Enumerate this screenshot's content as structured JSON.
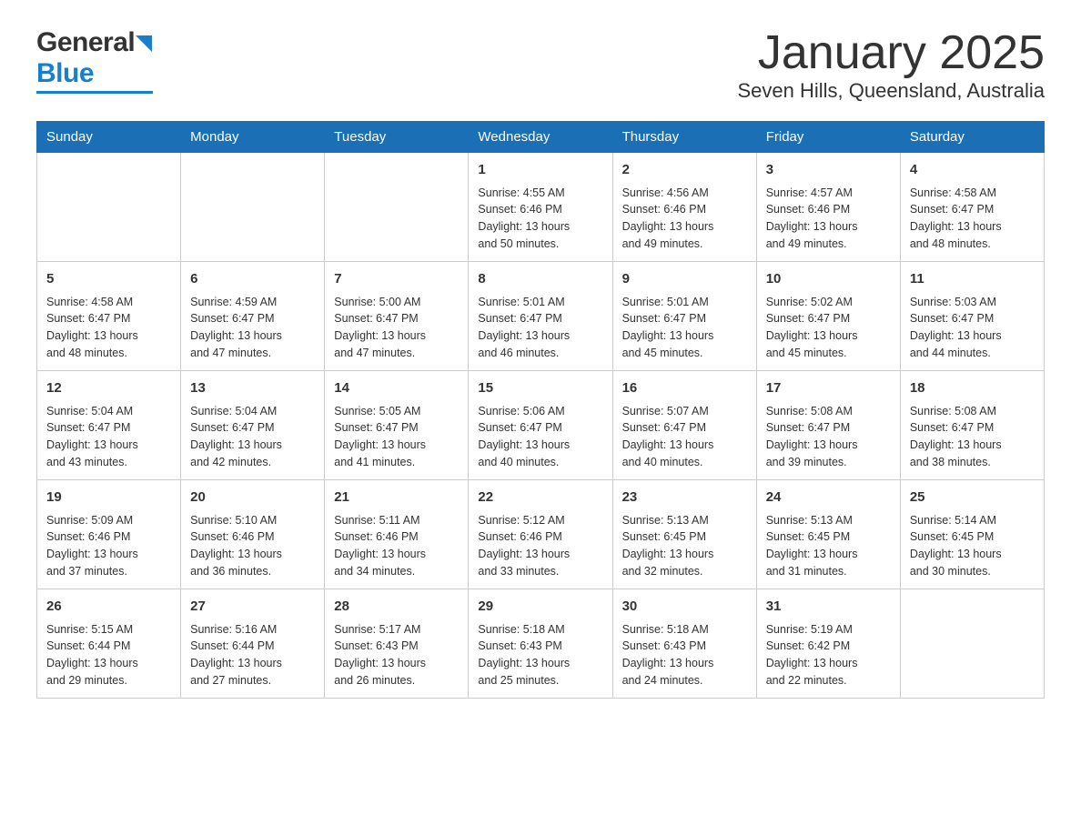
{
  "logo": {
    "general": "General",
    "blue": "Blue"
  },
  "header": {
    "month": "January 2025",
    "location": "Seven Hills, Queensland, Australia"
  },
  "weekdays": [
    "Sunday",
    "Monday",
    "Tuesday",
    "Wednesday",
    "Thursday",
    "Friday",
    "Saturday"
  ],
  "weeks": [
    [
      {
        "day": "",
        "info": ""
      },
      {
        "day": "",
        "info": ""
      },
      {
        "day": "",
        "info": ""
      },
      {
        "day": "1",
        "info": "Sunrise: 4:55 AM\nSunset: 6:46 PM\nDaylight: 13 hours\nand 50 minutes."
      },
      {
        "day": "2",
        "info": "Sunrise: 4:56 AM\nSunset: 6:46 PM\nDaylight: 13 hours\nand 49 minutes."
      },
      {
        "day": "3",
        "info": "Sunrise: 4:57 AM\nSunset: 6:46 PM\nDaylight: 13 hours\nand 49 minutes."
      },
      {
        "day": "4",
        "info": "Sunrise: 4:58 AM\nSunset: 6:47 PM\nDaylight: 13 hours\nand 48 minutes."
      }
    ],
    [
      {
        "day": "5",
        "info": "Sunrise: 4:58 AM\nSunset: 6:47 PM\nDaylight: 13 hours\nand 48 minutes."
      },
      {
        "day": "6",
        "info": "Sunrise: 4:59 AM\nSunset: 6:47 PM\nDaylight: 13 hours\nand 47 minutes."
      },
      {
        "day": "7",
        "info": "Sunrise: 5:00 AM\nSunset: 6:47 PM\nDaylight: 13 hours\nand 47 minutes."
      },
      {
        "day": "8",
        "info": "Sunrise: 5:01 AM\nSunset: 6:47 PM\nDaylight: 13 hours\nand 46 minutes."
      },
      {
        "day": "9",
        "info": "Sunrise: 5:01 AM\nSunset: 6:47 PM\nDaylight: 13 hours\nand 45 minutes."
      },
      {
        "day": "10",
        "info": "Sunrise: 5:02 AM\nSunset: 6:47 PM\nDaylight: 13 hours\nand 45 minutes."
      },
      {
        "day": "11",
        "info": "Sunrise: 5:03 AM\nSunset: 6:47 PM\nDaylight: 13 hours\nand 44 minutes."
      }
    ],
    [
      {
        "day": "12",
        "info": "Sunrise: 5:04 AM\nSunset: 6:47 PM\nDaylight: 13 hours\nand 43 minutes."
      },
      {
        "day": "13",
        "info": "Sunrise: 5:04 AM\nSunset: 6:47 PM\nDaylight: 13 hours\nand 42 minutes."
      },
      {
        "day": "14",
        "info": "Sunrise: 5:05 AM\nSunset: 6:47 PM\nDaylight: 13 hours\nand 41 minutes."
      },
      {
        "day": "15",
        "info": "Sunrise: 5:06 AM\nSunset: 6:47 PM\nDaylight: 13 hours\nand 40 minutes."
      },
      {
        "day": "16",
        "info": "Sunrise: 5:07 AM\nSunset: 6:47 PM\nDaylight: 13 hours\nand 40 minutes."
      },
      {
        "day": "17",
        "info": "Sunrise: 5:08 AM\nSunset: 6:47 PM\nDaylight: 13 hours\nand 39 minutes."
      },
      {
        "day": "18",
        "info": "Sunrise: 5:08 AM\nSunset: 6:47 PM\nDaylight: 13 hours\nand 38 minutes."
      }
    ],
    [
      {
        "day": "19",
        "info": "Sunrise: 5:09 AM\nSunset: 6:46 PM\nDaylight: 13 hours\nand 37 minutes."
      },
      {
        "day": "20",
        "info": "Sunrise: 5:10 AM\nSunset: 6:46 PM\nDaylight: 13 hours\nand 36 minutes."
      },
      {
        "day": "21",
        "info": "Sunrise: 5:11 AM\nSunset: 6:46 PM\nDaylight: 13 hours\nand 34 minutes."
      },
      {
        "day": "22",
        "info": "Sunrise: 5:12 AM\nSunset: 6:46 PM\nDaylight: 13 hours\nand 33 minutes."
      },
      {
        "day": "23",
        "info": "Sunrise: 5:13 AM\nSunset: 6:45 PM\nDaylight: 13 hours\nand 32 minutes."
      },
      {
        "day": "24",
        "info": "Sunrise: 5:13 AM\nSunset: 6:45 PM\nDaylight: 13 hours\nand 31 minutes."
      },
      {
        "day": "25",
        "info": "Sunrise: 5:14 AM\nSunset: 6:45 PM\nDaylight: 13 hours\nand 30 minutes."
      }
    ],
    [
      {
        "day": "26",
        "info": "Sunrise: 5:15 AM\nSunset: 6:44 PM\nDaylight: 13 hours\nand 29 minutes."
      },
      {
        "day": "27",
        "info": "Sunrise: 5:16 AM\nSunset: 6:44 PM\nDaylight: 13 hours\nand 27 minutes."
      },
      {
        "day": "28",
        "info": "Sunrise: 5:17 AM\nSunset: 6:43 PM\nDaylight: 13 hours\nand 26 minutes."
      },
      {
        "day": "29",
        "info": "Sunrise: 5:18 AM\nSunset: 6:43 PM\nDaylight: 13 hours\nand 25 minutes."
      },
      {
        "day": "30",
        "info": "Sunrise: 5:18 AM\nSunset: 6:43 PM\nDaylight: 13 hours\nand 24 minutes."
      },
      {
        "day": "31",
        "info": "Sunrise: 5:19 AM\nSunset: 6:42 PM\nDaylight: 13 hours\nand 22 minutes."
      },
      {
        "day": "",
        "info": ""
      }
    ]
  ]
}
